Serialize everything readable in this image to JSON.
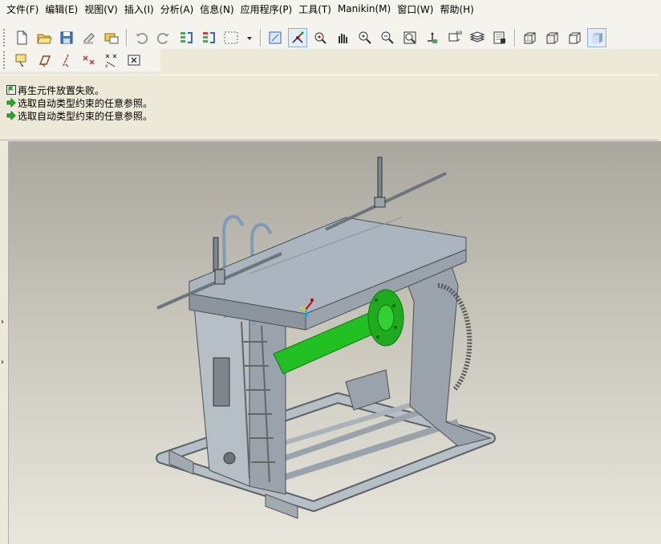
{
  "menu": {
    "items": [
      {
        "name": "menu-file",
        "label": "文件(F)"
      },
      {
        "name": "menu-edit",
        "label": "编辑(E)"
      },
      {
        "name": "menu-view",
        "label": "视图(V)"
      },
      {
        "name": "menu-insert",
        "label": "插入(I)"
      },
      {
        "name": "menu-analysis",
        "label": "分析(A)"
      },
      {
        "name": "menu-info",
        "label": "信息(N)"
      },
      {
        "name": "menu-applications",
        "label": "应用程序(P)"
      },
      {
        "name": "menu-tools",
        "label": "工具(T)"
      },
      {
        "name": "menu-manikin",
        "label": "Manikin(M)"
      },
      {
        "name": "menu-window",
        "label": "窗口(W)"
      },
      {
        "name": "menu-help",
        "label": "帮助(H)"
      }
    ]
  },
  "messages": [
    {
      "icon": "warning-flag-icon",
      "text": "再生元件放置失败。"
    },
    {
      "icon": "green-arrow-icon",
      "text": "选取自动类型约束的任意参照。"
    },
    {
      "icon": "green-arrow-icon",
      "text": "选取自动类型约束的任意参照。"
    }
  ],
  "toolbar": {
    "row1_icons": [
      "new-file-icon",
      "open-folder-icon",
      "save-icon",
      "print-icon",
      "email-icon",
      "undo-icon",
      "redo-icon",
      "regenerate-icon",
      "regenerate-manager-icon",
      "select-box-icon",
      "dropdown-icon",
      "repaint-icon",
      "spin-center-icon",
      "orient-mode-icon",
      "pan-icon",
      "zoom-in-icon",
      "zoom-out-icon",
      "refit-icon",
      "reorient-icon",
      "saved-views-icon",
      "layers-icon",
      "view-manager-icon",
      "wireframe-icon",
      "hidden-line-icon",
      "no-hidden-icon",
      "shading-icon"
    ],
    "row2_icons": [
      "datum-planes-icon",
      "datum-axes-icon",
      "datum-points-icon",
      "coordinate-systems-icon",
      "annotations-icon",
      "close-window-icon"
    ]
  },
  "colors": {
    "accent_selected": "#316ac5",
    "part_green": "#22c022",
    "model_steel": "#b7bfc6"
  }
}
